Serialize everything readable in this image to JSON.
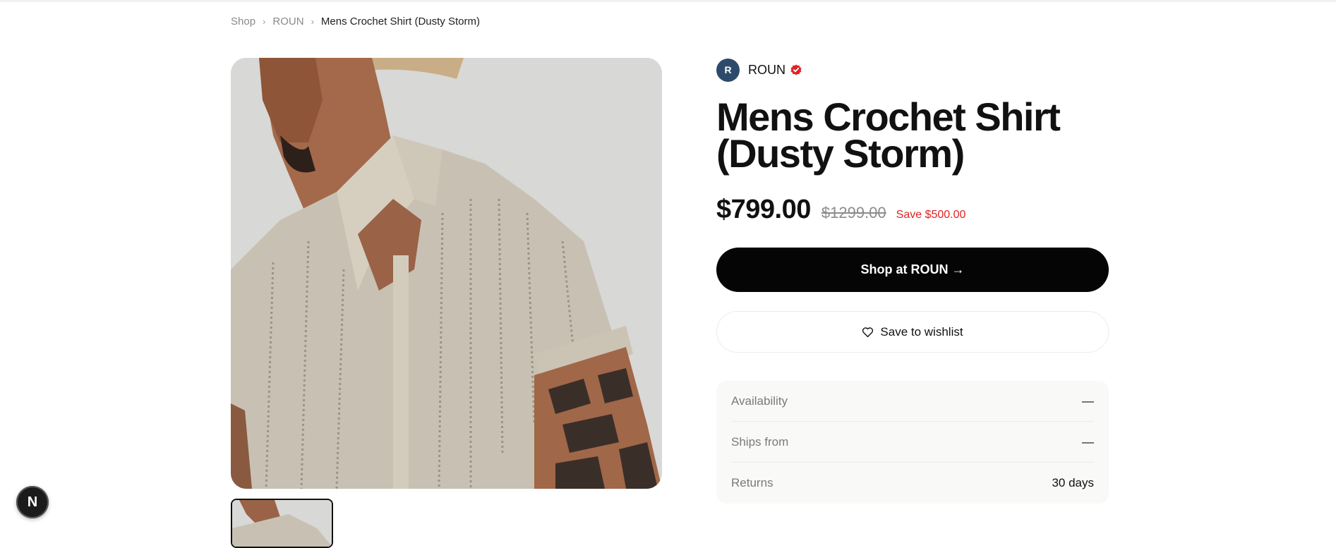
{
  "breadcrumb": {
    "items": [
      "Shop",
      "ROUN"
    ],
    "current": "Mens Crochet Shirt (Dusty Storm)"
  },
  "fab": {
    "label": "N"
  },
  "brand": {
    "initial": "R",
    "name": "ROUN",
    "avatar_color": "#2e4a6b",
    "verified_color": "#e02424"
  },
  "product": {
    "title": "Mens Crochet Shirt (Dusty Storm)",
    "price": "$799.00",
    "original_price": "$1299.00",
    "savings": "Save $500.00"
  },
  "actions": {
    "shop_label": "Shop at ROUN →",
    "wishlist_label": "Save to wishlist"
  },
  "details": [
    {
      "label": "Availability",
      "value": "—"
    },
    {
      "label": "Ships from",
      "value": "—"
    },
    {
      "label": "Returns",
      "value": "30 days"
    }
  ],
  "icons": {
    "verified": "verified-badge-icon",
    "wishlist": "heart-icon",
    "chevron": "chevron-right-icon"
  }
}
